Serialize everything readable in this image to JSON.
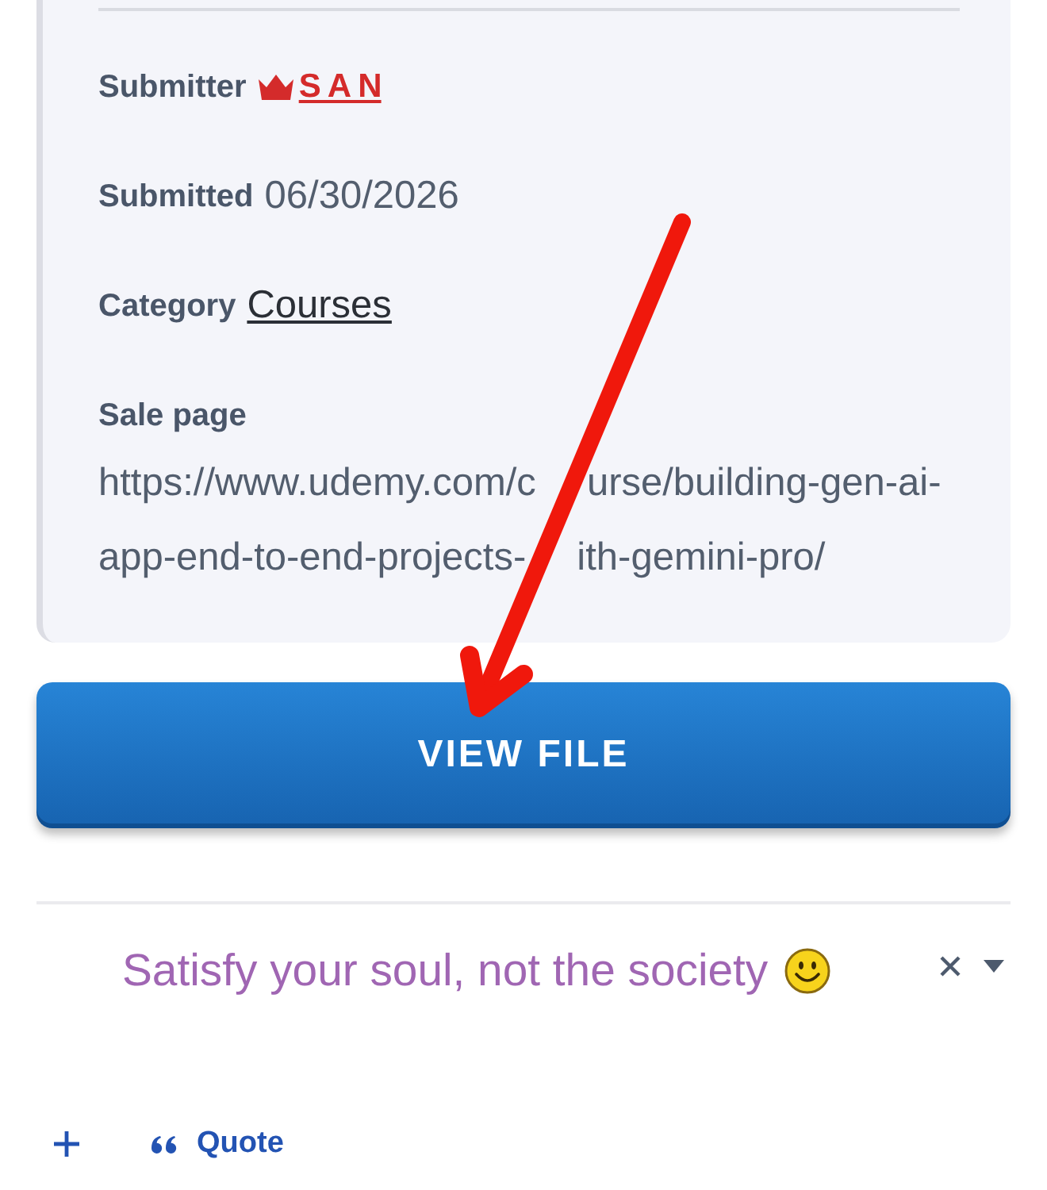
{
  "details": {
    "fields": [
      {
        "kind": "user",
        "label": "Submitter",
        "value": "S A N"
      },
      {
        "kind": "text",
        "label": "Submitted",
        "value": "06/30/2026"
      },
      {
        "kind": "link",
        "label": "Category",
        "value": "Courses"
      },
      {
        "kind": "block",
        "label": "Sale page",
        "lines": [
          [
            "https://www.udemy.com/c",
            "urse/building-gen-ai-"
          ],
          [
            "app-end-to-end-projects-",
            "ith-gemini-pro/"
          ]
        ]
      }
    ]
  },
  "view_file_button": {
    "label": "VIEW FILE"
  },
  "signature": {
    "text": "Satisfy your soul, not the society"
  },
  "toolbar": {
    "items": [
      {
        "kind": "add"
      },
      {
        "kind": "quote",
        "label": "Quote"
      }
    ]
  }
}
